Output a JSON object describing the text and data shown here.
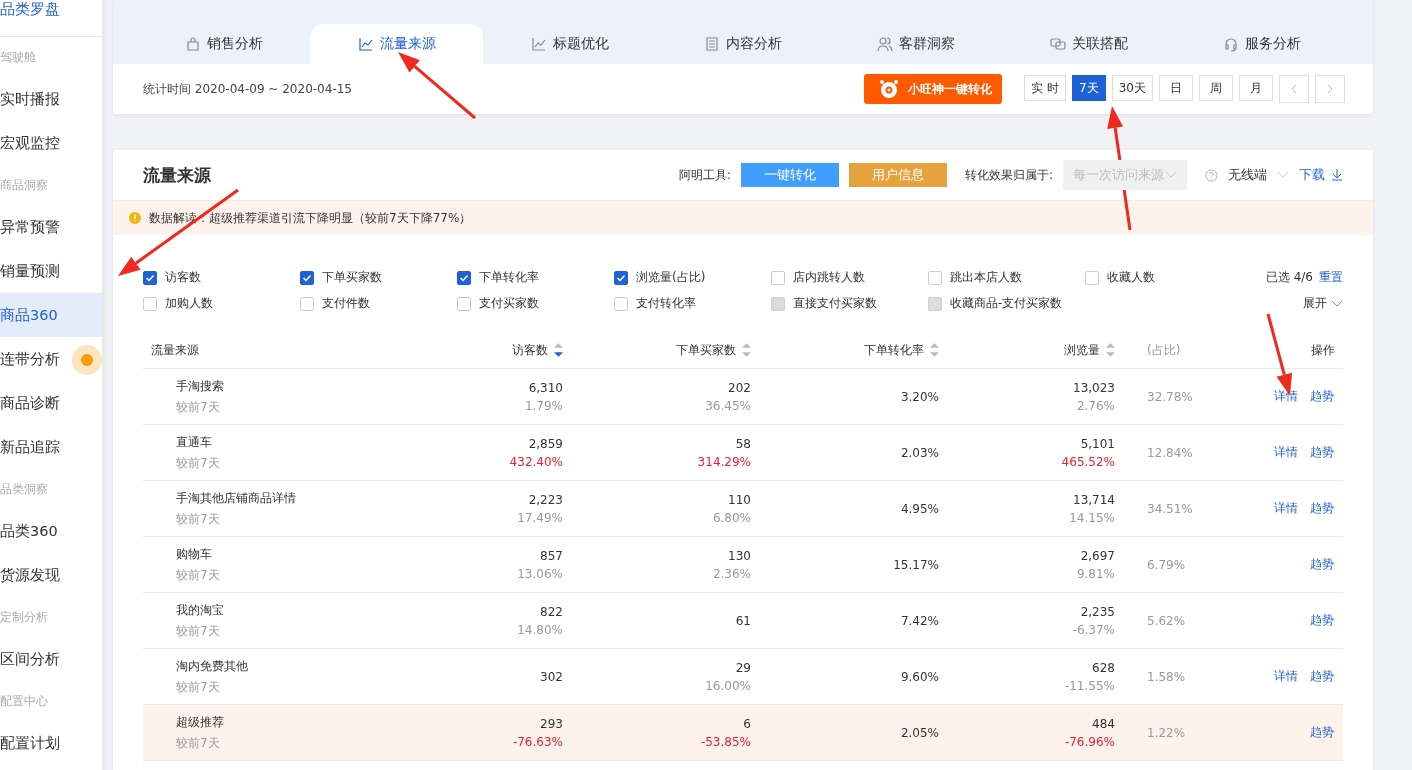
{
  "sidebar": {
    "title": "品类罗盘",
    "sections": [
      {
        "heading": "驾驶舱",
        "items": [
          {
            "label": "实时播报",
            "selected": false,
            "marker": false
          },
          {
            "label": "宏观监控",
            "selected": false,
            "marker": false
          }
        ]
      },
      {
        "heading": "商品洞察",
        "items": [
          {
            "label": "异常预警",
            "selected": false,
            "marker": false
          },
          {
            "label": "销量预测",
            "selected": false,
            "marker": false
          },
          {
            "label": "商品360",
            "selected": true,
            "marker": false
          },
          {
            "label": "连带分析",
            "selected": false,
            "marker": true
          },
          {
            "label": "商品诊断",
            "selected": false,
            "marker": false
          },
          {
            "label": "新品追踪",
            "selected": false,
            "marker": false
          }
        ]
      },
      {
        "heading": "品类洞察",
        "items": [
          {
            "label": "品类360",
            "selected": false,
            "marker": false
          },
          {
            "label": "货源发现",
            "selected": false,
            "marker": false
          }
        ]
      },
      {
        "heading": "定制分析",
        "items": [
          {
            "label": "区间分析",
            "selected": false,
            "marker": false
          }
        ]
      },
      {
        "heading": "配置中心",
        "items": [
          {
            "label": "配置计划",
            "selected": false,
            "marker": false
          }
        ]
      }
    ]
  },
  "tabs": [
    {
      "label": "销售分析",
      "selected": false
    },
    {
      "label": "流量来源",
      "selected": true
    },
    {
      "label": "标题优化",
      "selected": false
    },
    {
      "label": "内容分析",
      "selected": false
    },
    {
      "label": "客群洞察",
      "selected": false
    },
    {
      "label": "关联搭配",
      "selected": false
    },
    {
      "label": "服务分析",
      "selected": false
    }
  ],
  "date_range": "统计时间 2020-04-09 ~ 2020-04-15",
  "promo_button": "小旺神一键转化",
  "periods": [
    {
      "label": "实 时",
      "selected": false
    },
    {
      "label": "7天",
      "selected": true
    },
    {
      "label": "30天",
      "selected": false
    },
    {
      "label": "日",
      "selected": false
    },
    {
      "label": "周",
      "selected": false
    },
    {
      "label": "月",
      "selected": false
    }
  ],
  "panel": {
    "title": "流量来源",
    "tools_label": "阿明工具:",
    "tool_buttons": [
      {
        "label": "一键转化",
        "color": "#409eff"
      },
      {
        "label": "用户信息",
        "color": "#e6a23c"
      }
    ],
    "attribution_label": "转化效果归属于:",
    "attribution_select": {
      "value": "每一次访问来源",
      "disabled": true
    },
    "device_select": "无线端",
    "download": "下载",
    "notice": "数据解读：超级推荐渠道引流下降明显（较前7天下降77%）",
    "metrics": [
      {
        "label": "访客数",
        "checked": true,
        "disabled": false
      },
      {
        "label": "下单买家数",
        "checked": true,
        "disabled": false
      },
      {
        "label": "下单转化率",
        "checked": true,
        "disabled": false
      },
      {
        "label": "浏览量(占比)",
        "checked": true,
        "disabled": false
      },
      {
        "label": "店内跳转人数",
        "checked": false,
        "disabled": false
      },
      {
        "label": "跳出本店人数",
        "checked": false,
        "disabled": false
      },
      {
        "label": "收藏人数",
        "checked": false,
        "disabled": false
      },
      {
        "label": "加购人数",
        "checked": false,
        "disabled": false
      },
      {
        "label": "支付件数",
        "checked": false,
        "disabled": false
      },
      {
        "label": "支付买家数",
        "checked": false,
        "disabled": false
      },
      {
        "label": "支付转化率",
        "checked": false,
        "disabled": false
      },
      {
        "label": "直接支付买家数",
        "checked": false,
        "disabled": true
      },
      {
        "label": "收藏商品-支付买家数",
        "checked": false,
        "disabled": true
      }
    ],
    "selected_count": "已选 4/6",
    "reset": "重置",
    "expand": "展开",
    "table": {
      "columns": [
        {
          "label": "流量来源",
          "sorted": false,
          "sortable": false
        },
        {
          "label": "访客数",
          "sorted": true,
          "sortable": true
        },
        {
          "label": "下单买家数",
          "sorted": false,
          "sortable": true
        },
        {
          "label": "下单转化率",
          "sorted": false,
          "sortable": true
        },
        {
          "label": "浏览量",
          "sorted": false,
          "sortable": true
        },
        {
          "label": "(占比)",
          "sorted": false,
          "sortable": false
        },
        {
          "label": "操作",
          "sorted": false,
          "sortable": false
        }
      ],
      "rows": [
        {
          "source": "手淘搜索",
          "compare": "较前7天",
          "visitors": "6,310",
          "visitors_change": "1.79%",
          "visitors_alert": false,
          "buyers": "202",
          "buyers_change": "36.45%",
          "buyers_alert": false,
          "rate": "3.20%",
          "pv": "13,023",
          "pv_change": "2.76%",
          "pv_alert": false,
          "share": "32.78%",
          "detail": "详情",
          "trend": "趋势",
          "highlighted": false
        },
        {
          "source": "直通车",
          "compare": "较前7天",
          "visitors": "2,859",
          "visitors_change": "432.40%",
          "visitors_alert": true,
          "buyers": "58",
          "buyers_change": "314.29%",
          "buyers_alert": true,
          "rate": "2.03%",
          "pv": "5,101",
          "pv_change": "465.52%",
          "pv_alert": true,
          "share": "12.84%",
          "detail": "详情",
          "trend": "趋势",
          "highlighted": false
        },
        {
          "source": "手淘其他店铺商品详情",
          "compare": "较前7天",
          "visitors": "2,223",
          "visitors_change": "17.49%",
          "visitors_alert": false,
          "buyers": "110",
          "buyers_change": "6.80%",
          "buyers_alert": false,
          "rate": "4.95%",
          "pv": "13,714",
          "pv_change": "14.15%",
          "pv_alert": false,
          "share": "34.51%",
          "detail": "详情",
          "trend": "趋势",
          "highlighted": false
        },
        {
          "source": "购物车",
          "compare": "较前7天",
          "visitors": "857",
          "visitors_change": "13.06%",
          "visitors_alert": false,
          "buyers": "130",
          "buyers_change": "2.36%",
          "buyers_alert": false,
          "rate": "15.17%",
          "pv": "2,697",
          "pv_change": "9.81%",
          "pv_alert": false,
          "share": "6.79%",
          "trend": "趋势",
          "highlighted": false
        },
        {
          "source": "我的淘宝",
          "compare": "较前7天",
          "visitors": "822",
          "visitors_change": "14.80%",
          "visitors_alert": false,
          "buyers": "61",
          "rate": "7.42%",
          "pv": "2,235",
          "pv_change": "-6.37%",
          "pv_alert": false,
          "share": "5.62%",
          "trend": "趋势",
          "highlighted": false
        },
        {
          "source": "淘内免费其他",
          "compare": "较前7天",
          "visitors": "302",
          "buyers": "29",
          "buyers_change": "16.00%",
          "buyers_alert": false,
          "rate": "9.60%",
          "pv": "628",
          "pv_change": "-11.55%",
          "pv_alert": false,
          "share": "1.58%",
          "detail": "详情",
          "trend": "趋势",
          "highlighted": false
        },
        {
          "source": "超级推荐",
          "compare": "较前7天",
          "visitors": "293",
          "visitors_change": "-76.63%",
          "visitors_alert": true,
          "buyers": "6",
          "buyers_change": "-53.85%",
          "buyers_alert": true,
          "rate": "2.05%",
          "pv": "484",
          "pv_change": "-76.96%",
          "pv_alert": true,
          "share": "1.22%",
          "trend": "趋势",
          "highlighted": true
        }
      ]
    }
  }
}
